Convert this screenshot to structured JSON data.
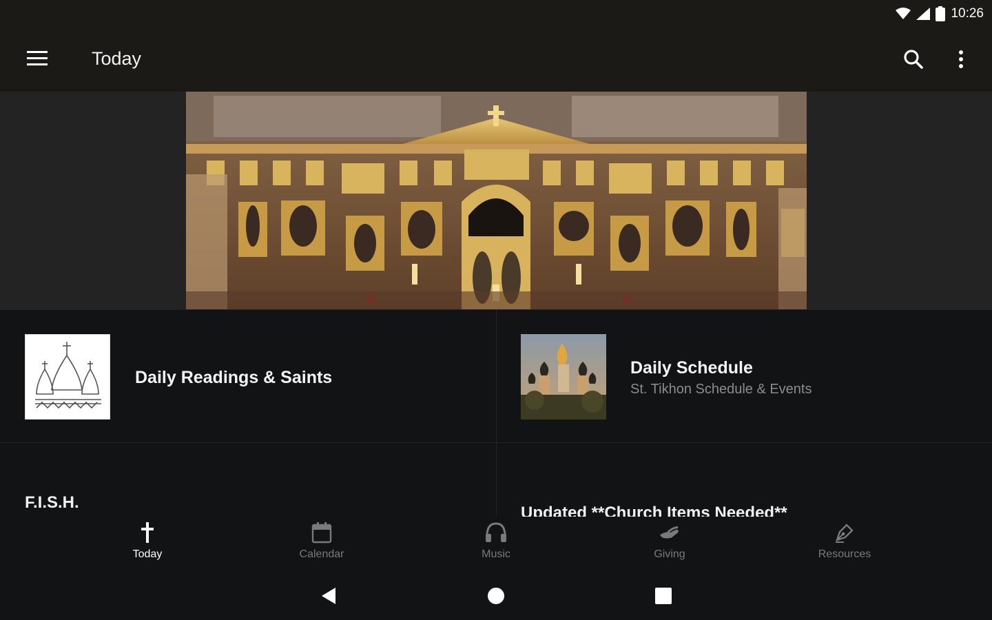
{
  "status_bar": {
    "time": "10:26"
  },
  "app_bar": {
    "title": "Today"
  },
  "cards": [
    {
      "title": "Daily Readings & Saints",
      "subtitle": ""
    },
    {
      "title": "Daily Schedule",
      "subtitle": "St. Tikhon Schedule & Events"
    }
  ],
  "sections": {
    "left_title": "F.I.S.H.",
    "right_title": "Updated **Church Items Needed**"
  },
  "bottom_nav": [
    {
      "label": "Today",
      "icon": "cross-icon",
      "active": true
    },
    {
      "label": "Calendar",
      "icon": "calendar-icon",
      "active": false
    },
    {
      "label": "Music",
      "icon": "headphones-icon",
      "active": false
    },
    {
      "label": "Giving",
      "icon": "giving-hand-icon",
      "active": false
    },
    {
      "label": "Resources",
      "icon": "pen-icon",
      "active": false
    }
  ],
  "colors": {
    "app_bar_bg": "#1c1a17",
    "content_bg": "#121315",
    "active_nav": "#ffffff",
    "inactive_nav": "#7a7a7a"
  }
}
